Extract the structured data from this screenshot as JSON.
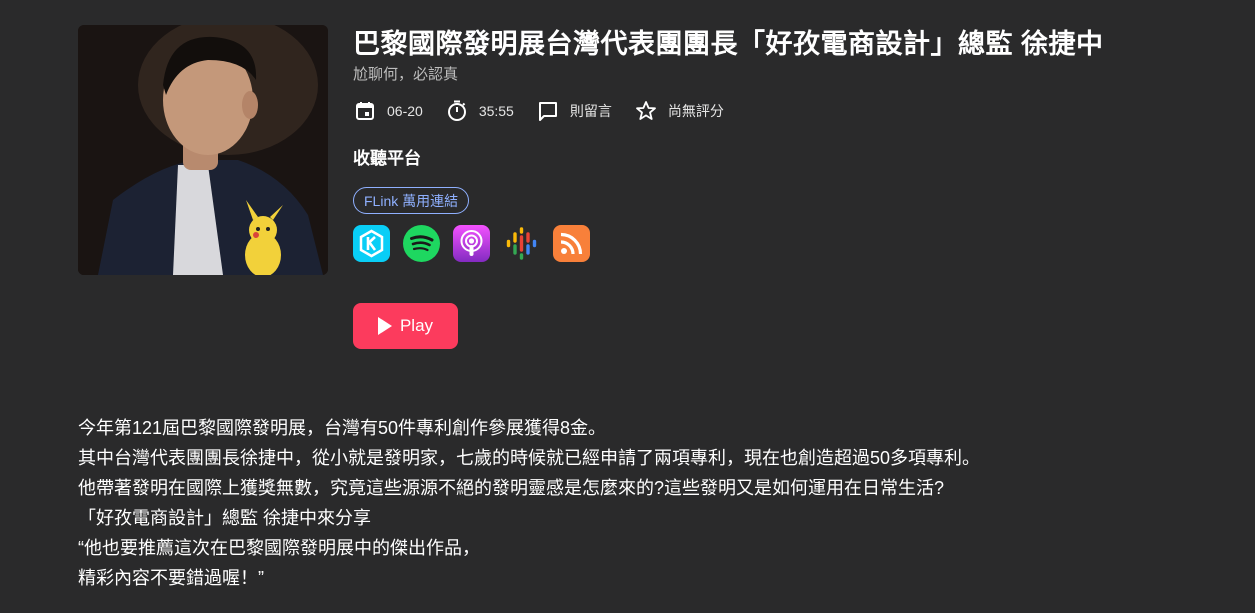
{
  "episode": {
    "title": "巴黎國際發明展台灣代表團團長「好孜電商設計」總監 徐捷中",
    "author": "尬聊何，必認真",
    "date": "06-20",
    "duration": "35:55",
    "comments_label": "則留言",
    "rating_label": "尚無評分"
  },
  "platforms_section": {
    "title": "收聽平台",
    "flink_label": "FLink 萬用連結",
    "icons": [
      "kkbox-icon",
      "spotify-icon",
      "apple-podcasts-icon",
      "google-podcasts-icon",
      "rss-icon"
    ]
  },
  "play_button": {
    "label": "Play"
  },
  "description": {
    "lines": [
      "今年第121屆巴黎國際發明展，台灣有50件專利創作參展獲得8金。",
      "其中台灣代表團團長徐捷中，從小就是發明家，七歲的時候就已經申請了兩項專利，現在也創造超過50多項專利。",
      "他帶著發明在國際上獲獎無數，究竟這些源源不絕的發明靈感是怎麼來的?這些發明又是如何運用在日常生活?",
      "「好孜電商設計」總監 徐捷中來分享",
      "“他也要推薦這次在巴黎國際發明展中的傑出作品，",
      "精彩內容不要錯過喔！”"
    ]
  },
  "colors": {
    "background": "#2a2a2b",
    "play_button": "#fc3b5d",
    "flink_border": "#8fb0ff"
  }
}
